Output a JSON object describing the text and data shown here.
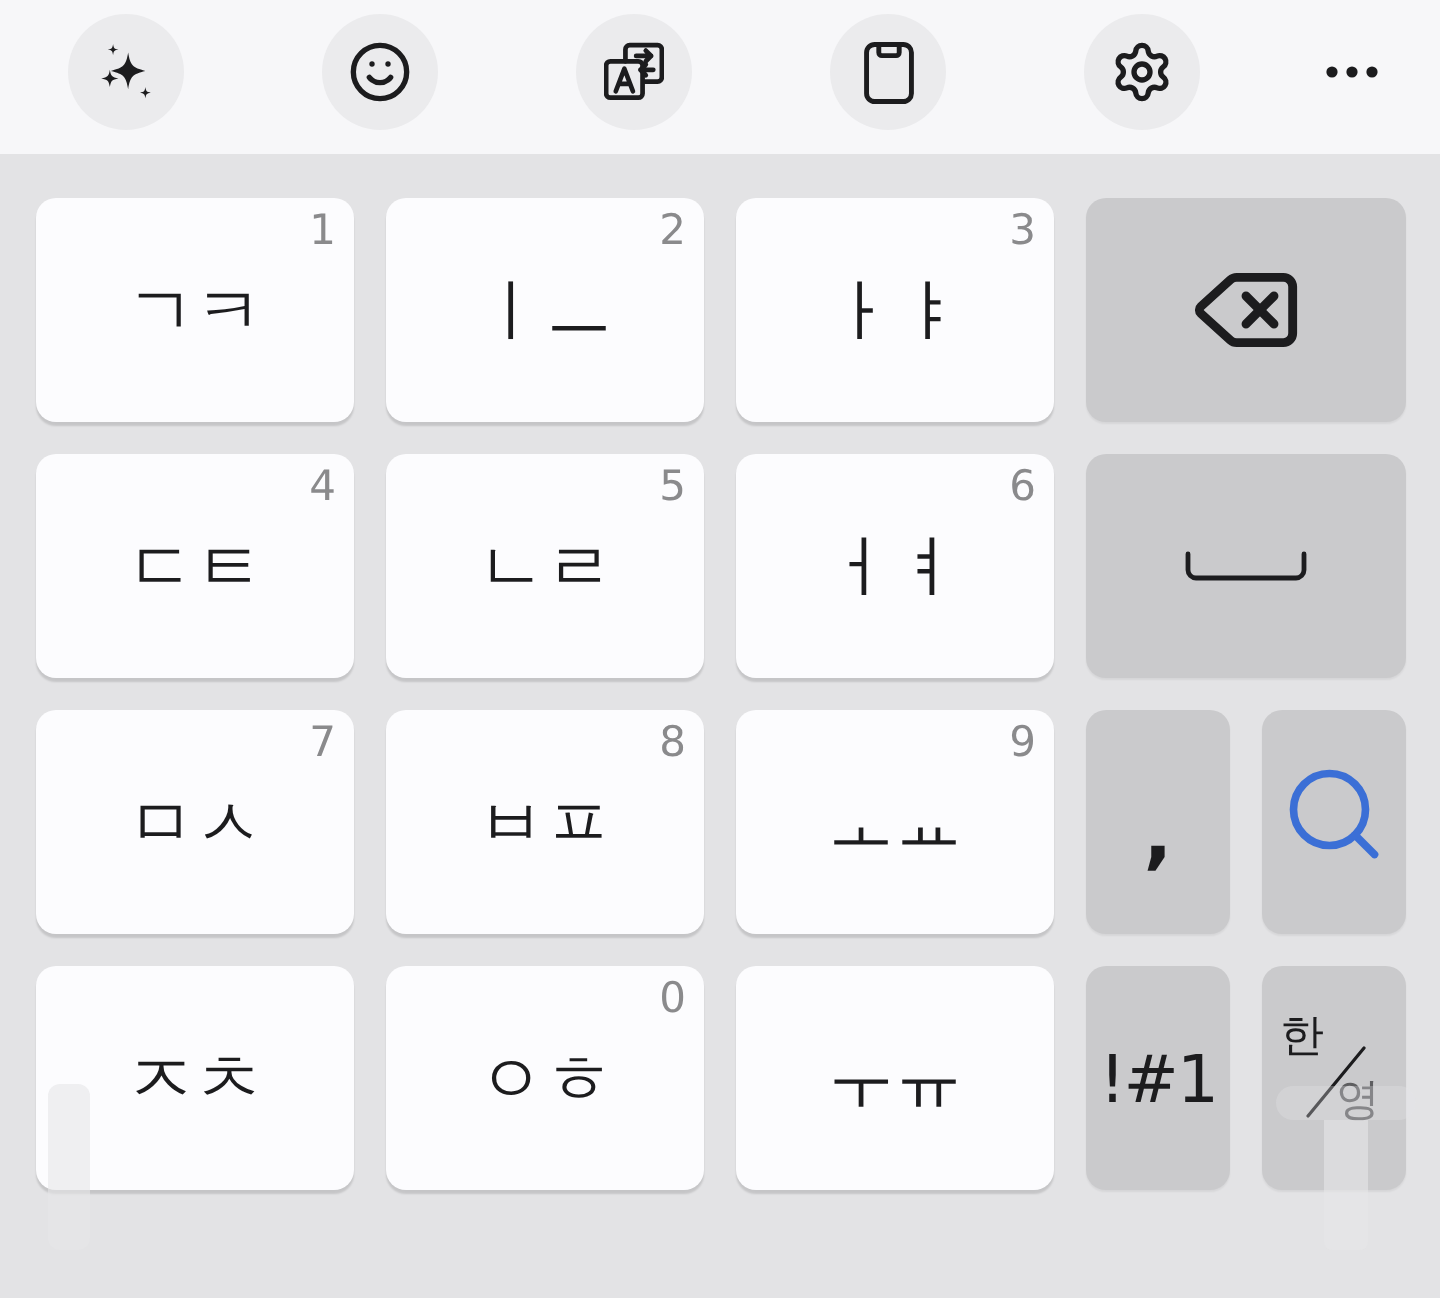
{
  "toolbar": {
    "buttons": [
      {
        "kind": "sparkle"
      },
      {
        "kind": "emoji"
      },
      {
        "kind": "translate"
      },
      {
        "kind": "clipboard"
      },
      {
        "kind": "settings"
      },
      {
        "kind": "more"
      }
    ]
  },
  "rows": [
    {
      "keys": [
        {
          "kind": "letter",
          "label": "ㄱㅋ",
          "number": "1"
        },
        {
          "kind": "letter",
          "label": "ㅣㅡ",
          "number": "2"
        },
        {
          "kind": "letter",
          "label": "ㅏㅑ",
          "number": "3"
        },
        {
          "kind": "backspace"
        }
      ]
    },
    {
      "keys": [
        {
          "kind": "letter",
          "label": "ㄷㅌ",
          "number": "4"
        },
        {
          "kind": "letter",
          "label": "ㄴㄹ",
          "number": "5"
        },
        {
          "kind": "letter",
          "label": "ㅓㅕ",
          "number": "6"
        },
        {
          "kind": "space"
        }
      ]
    },
    {
      "keys": [
        {
          "kind": "letter",
          "label": "ㅁㅅ",
          "number": "7"
        },
        {
          "kind": "letter",
          "label": "ㅂㅍ",
          "number": "8"
        },
        {
          "kind": "letter",
          "label": "ㅗㅛ",
          "number": "9"
        },
        {
          "kind": "punct",
          "label": ","
        },
        {
          "kind": "search"
        }
      ]
    },
    {
      "keys": [
        {
          "kind": "letter",
          "label": "ㅈㅊ"
        },
        {
          "kind": "letter",
          "label": "ㅇㅎ",
          "number": "0"
        },
        {
          "kind": "letter",
          "label": "ㅜㅠ"
        },
        {
          "kind": "symbols",
          "label": "!#1"
        },
        {
          "kind": "language",
          "primary": "한",
          "secondary": "영"
        }
      ]
    }
  ]
}
